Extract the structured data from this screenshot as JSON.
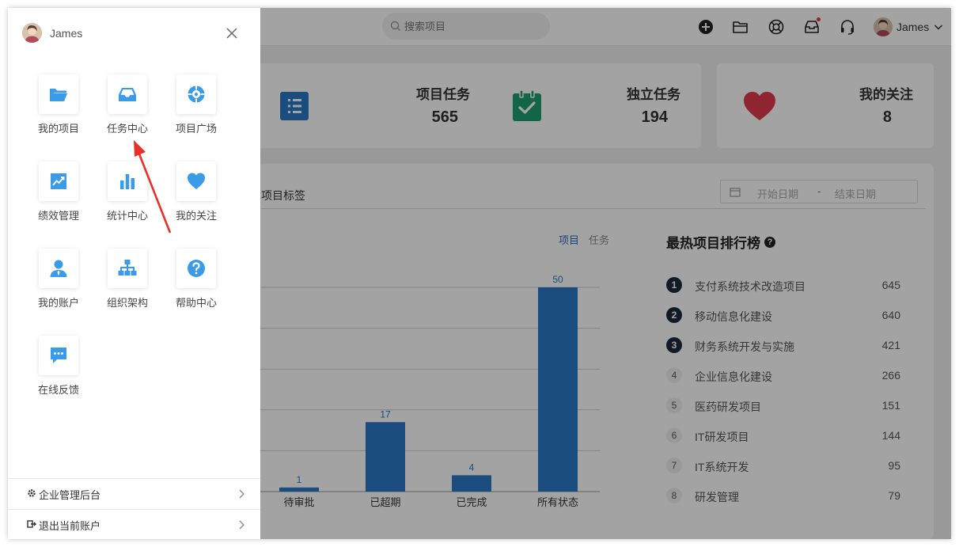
{
  "topbar": {
    "search_placeholder": "搜索项目",
    "icons": [
      "plus-circle-icon",
      "folder-icon",
      "lifebuoy-icon",
      "inbox-icon",
      "headset-icon"
    ],
    "user_name": "James"
  },
  "stats": [
    {
      "label": "项目任务",
      "value": "565",
      "icon": "list-icon",
      "color": "#2b78c5"
    },
    {
      "label": "独立任务",
      "value": "194",
      "icon": "clipboard-check-icon",
      "color": "#1f9e6f"
    },
    {
      "label": "我的关注",
      "value": "8",
      "icon": "heart-icon",
      "color": "#e03a4e"
    }
  ],
  "panel": {
    "tab_label": "项目标签",
    "date_start_placeholder": "开始日期",
    "date_separator": "-",
    "date_end_placeholder": "结束日期",
    "toggle_project": "项目",
    "toggle_task": "任务"
  },
  "chart_data": {
    "type": "bar",
    "categories": [
      "待审批",
      "已超期",
      "已完成",
      "所有状态"
    ],
    "values": [
      1,
      17,
      4,
      50
    ],
    "ylim": [
      0,
      50
    ],
    "grid": true,
    "bar_color": "#2b78c5",
    "label_color": "#2b78c5"
  },
  "ranking": {
    "title": "最热项目排行榜",
    "help_glyph": "?",
    "items": [
      {
        "rank": "1",
        "name": "支付系统技术改造项目",
        "value": "645"
      },
      {
        "rank": "2",
        "name": "移动信息化建设",
        "value": "640"
      },
      {
        "rank": "3",
        "name": "财务系统开发与实施",
        "value": "421"
      },
      {
        "rank": "4",
        "name": "企业信息化建设",
        "value": "266"
      },
      {
        "rank": "5",
        "name": "医药研发项目",
        "value": "151"
      },
      {
        "rank": "6",
        "name": "IT研发项目",
        "value": "144"
      },
      {
        "rank": "7",
        "name": "IT系统开发",
        "value": "95"
      },
      {
        "rank": "8",
        "name": "研发管理",
        "value": "79"
      }
    ]
  },
  "drawer": {
    "user_name": "James",
    "apps": [
      {
        "label": "我的项目",
        "icon": "folder-open-icon"
      },
      {
        "label": "任务中心",
        "icon": "inbox-icon"
      },
      {
        "label": "项目广场",
        "icon": "compass-icon"
      },
      {
        "label": "绩效管理",
        "icon": "trend-chart-icon"
      },
      {
        "label": "统计中心",
        "icon": "bar-chart-icon"
      },
      {
        "label": "我的关注",
        "icon": "heart-icon"
      },
      {
        "label": "我的账户",
        "icon": "user-icon"
      },
      {
        "label": "组织架构",
        "icon": "org-chart-icon"
      },
      {
        "label": "帮助中心",
        "icon": "help-circle-icon"
      },
      {
        "label": "在线反馈",
        "icon": "chat-icon"
      }
    ],
    "accent": "#3a9be8",
    "links": [
      {
        "label": "企业管理后台",
        "icon": "gear-icon"
      },
      {
        "label": "退出当前账户",
        "icon": "logout-icon"
      }
    ]
  }
}
